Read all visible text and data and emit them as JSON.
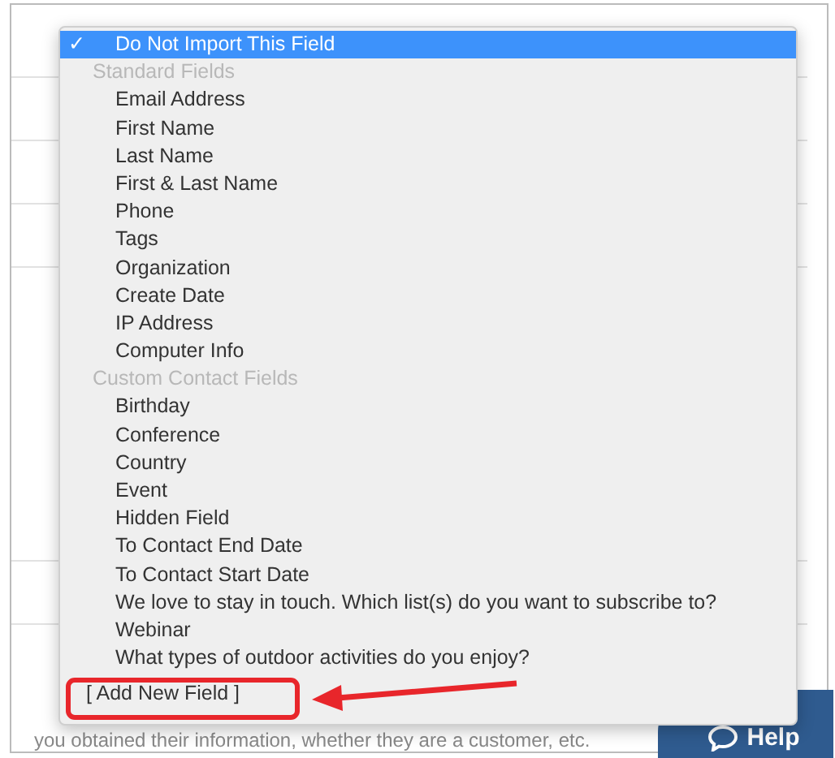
{
  "menu": {
    "items": [
      {
        "kind": "option",
        "label": "Do Not Import This Field",
        "checked": true,
        "selected": true
      },
      {
        "kind": "header",
        "label": "Standard Fields"
      },
      {
        "kind": "option",
        "label": "Email Address",
        "checked": false,
        "selected": false
      },
      {
        "kind": "option",
        "label": "First Name",
        "checked": false,
        "selected": false
      },
      {
        "kind": "option",
        "label": "Last Name",
        "checked": false,
        "selected": false
      },
      {
        "kind": "option",
        "label": "First & Last Name",
        "checked": false,
        "selected": false
      },
      {
        "kind": "option",
        "label": "Phone",
        "checked": false,
        "selected": false
      },
      {
        "kind": "option",
        "label": "Tags",
        "checked": false,
        "selected": false
      },
      {
        "kind": "option",
        "label": "Organization",
        "checked": false,
        "selected": false
      },
      {
        "kind": "option",
        "label": "Create Date",
        "checked": false,
        "selected": false
      },
      {
        "kind": "option",
        "label": "IP Address",
        "checked": false,
        "selected": false
      },
      {
        "kind": "option",
        "label": "Computer Info",
        "checked": false,
        "selected": false
      },
      {
        "kind": "header",
        "label": "Custom Contact Fields"
      },
      {
        "kind": "option",
        "label": "Birthday",
        "checked": false,
        "selected": false
      },
      {
        "kind": "option",
        "label": "Conference",
        "checked": false,
        "selected": false
      },
      {
        "kind": "option",
        "label": "Country",
        "checked": false,
        "selected": false
      },
      {
        "kind": "option",
        "label": "Event",
        "checked": false,
        "selected": false
      },
      {
        "kind": "option",
        "label": "Hidden Field",
        "checked": false,
        "selected": false
      },
      {
        "kind": "option",
        "label": "To Contact End Date",
        "checked": false,
        "selected": false
      },
      {
        "kind": "option",
        "label": "To Contact Start Date",
        "checked": false,
        "selected": false
      },
      {
        "kind": "option",
        "label": "We love to stay in touch. Which list(s) do you want to subscribe to?",
        "checked": false,
        "selected": false
      },
      {
        "kind": "option",
        "label": "Webinar",
        "checked": false,
        "selected": false
      },
      {
        "kind": "option",
        "label": "What types of outdoor activities do you enjoy?",
        "checked": false,
        "selected": false
      },
      {
        "kind": "action",
        "label": "[ Add New Field ]",
        "checked": false,
        "selected": false
      }
    ]
  },
  "check_mark": "✓",
  "page_text": "you obtained their information, whether they are a customer, etc.",
  "help_button": {
    "label": "Help"
  }
}
